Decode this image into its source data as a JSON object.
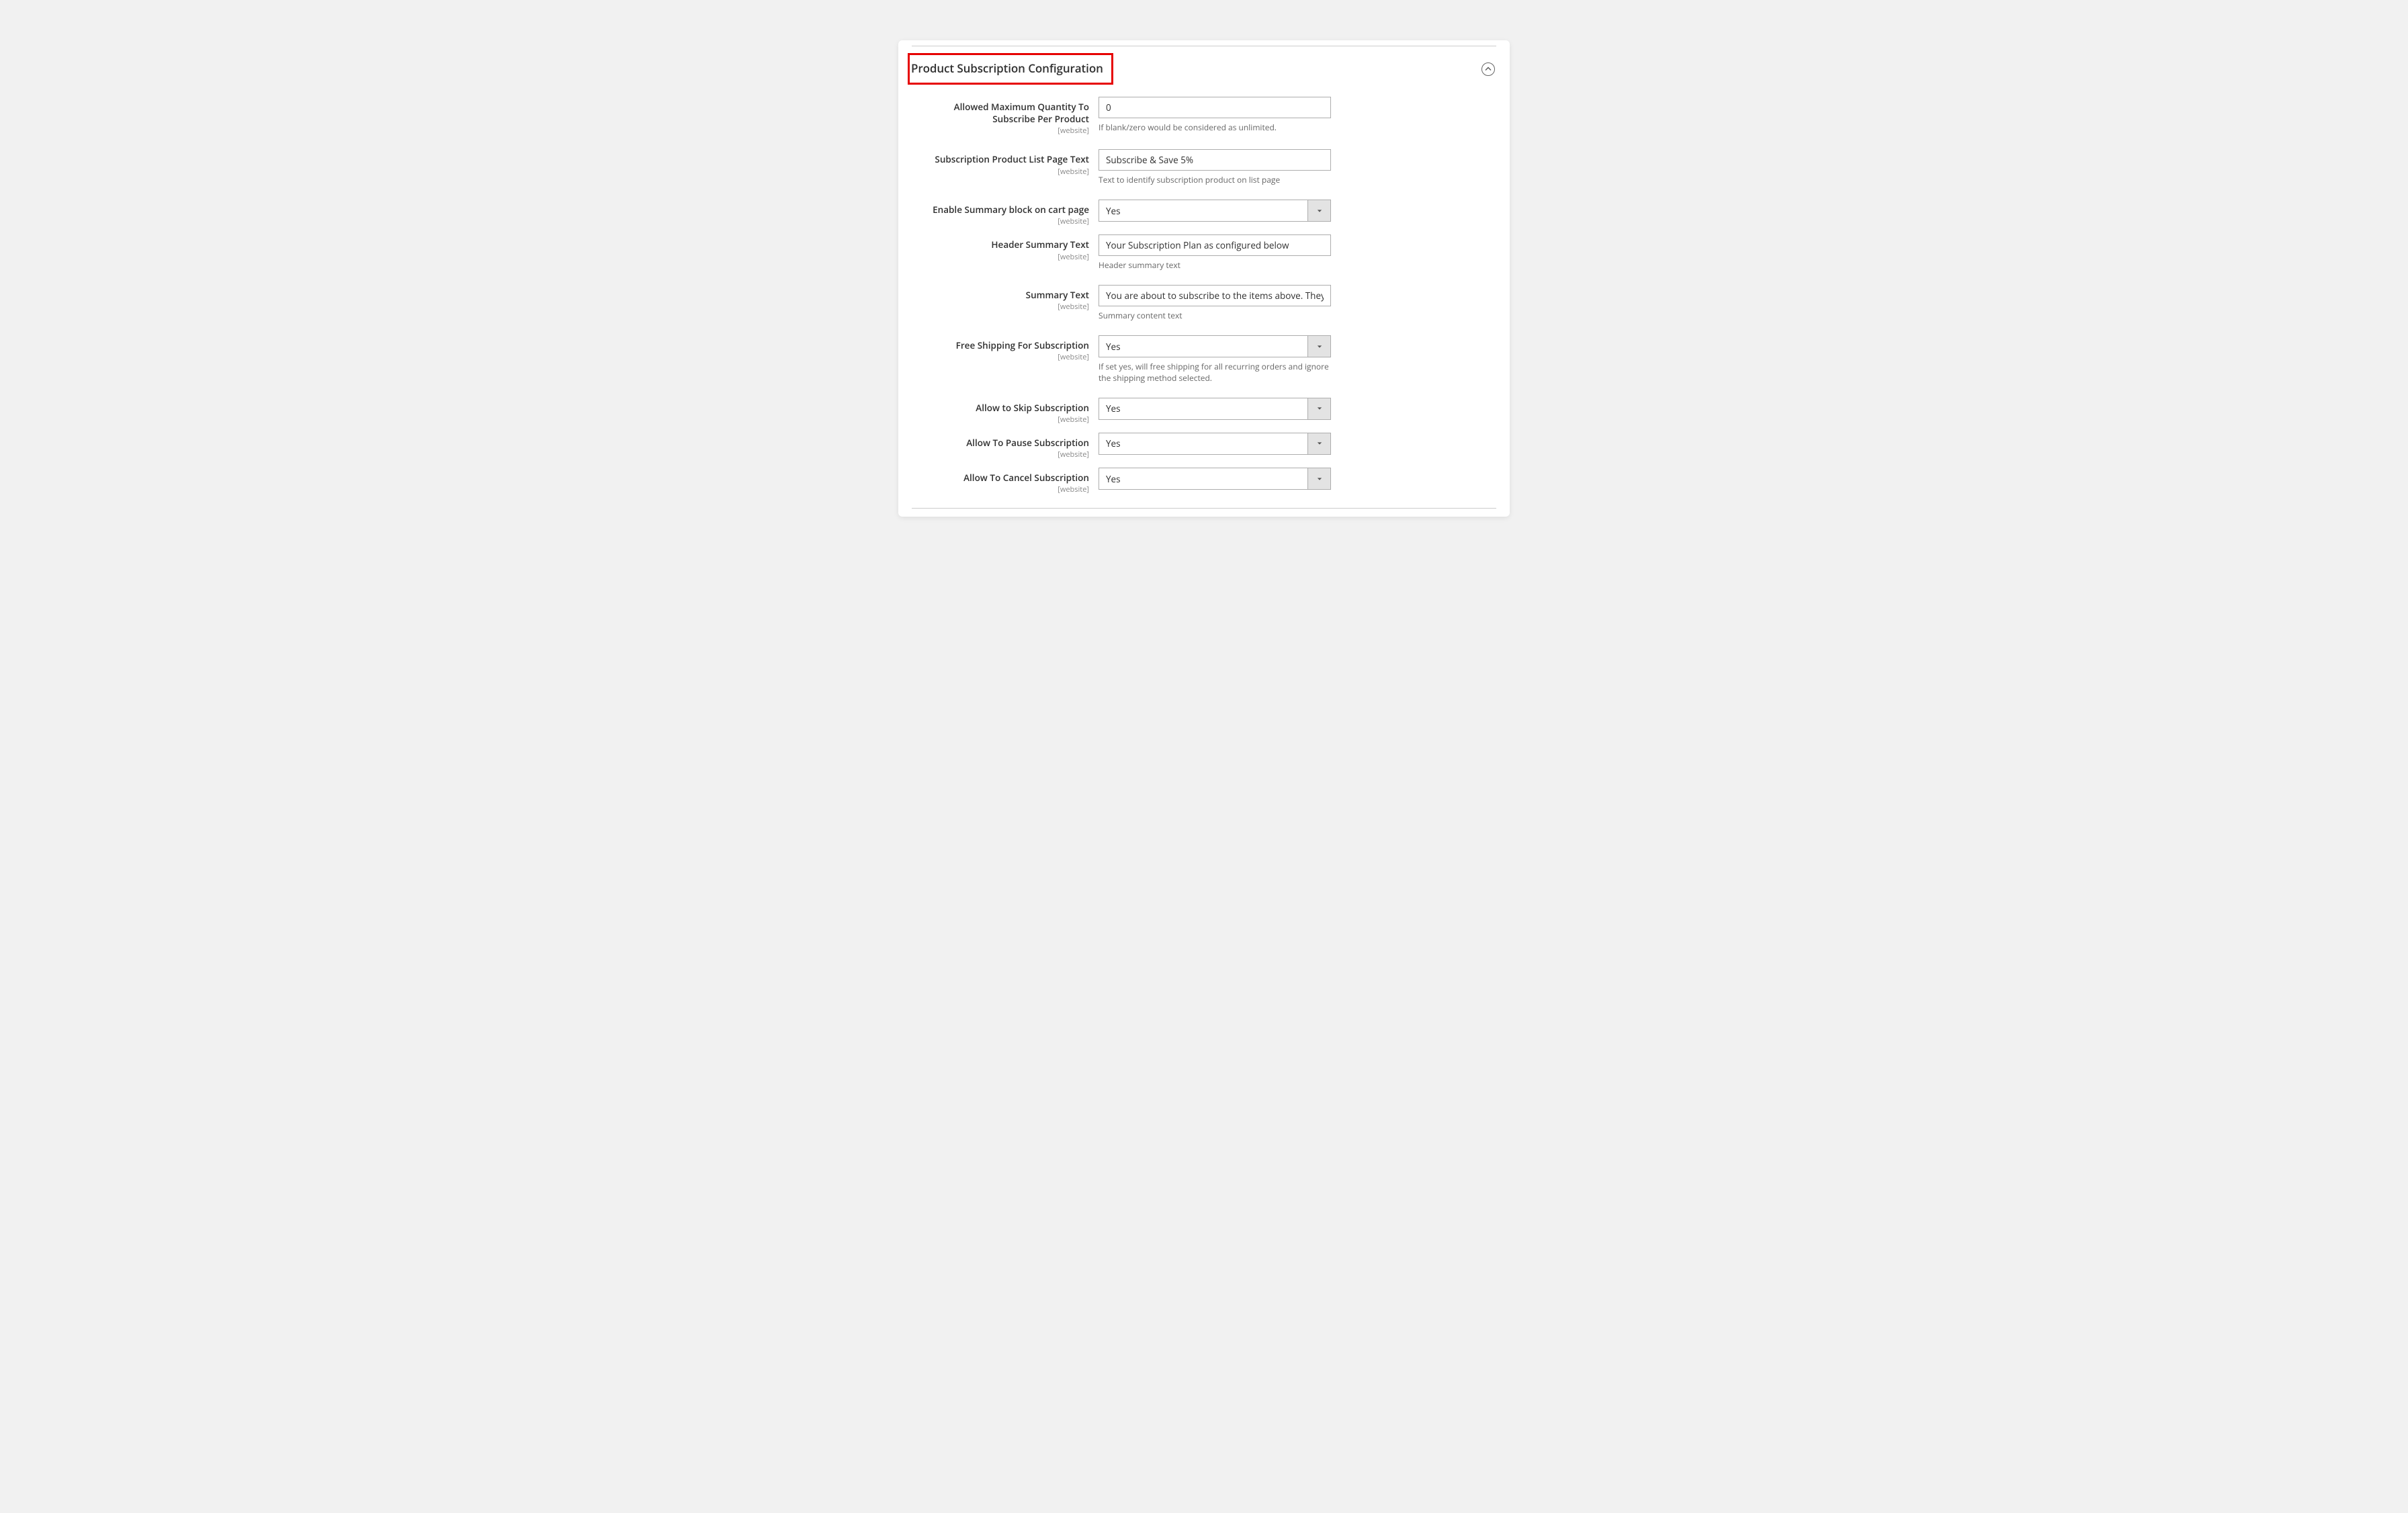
{
  "section": {
    "title": "Product Subscription Configuration"
  },
  "scope": "[website]",
  "fields": {
    "max_qty": {
      "label": "Allowed Maximum Quantity To Subscribe Per Product",
      "value": "0",
      "help": "If blank/zero would be considered as unlimited."
    },
    "list_text": {
      "label": "Subscription Product List Page Text",
      "value": "Subscribe & Save 5%",
      "help": "Text to identify subscription product on list page"
    },
    "enable_summary": {
      "label": "Enable Summary block on cart page",
      "value": "Yes"
    },
    "header_summary": {
      "label": "Header Summary Text",
      "value": "Your Subscription Plan as configured below",
      "help": "Header summary text"
    },
    "summary_text": {
      "label": "Summary Text",
      "value": "You are about to subscribe to the items above. They will be shipped to you on a recurring basis.",
      "help": "Summary content text"
    },
    "free_shipping": {
      "label": "Free Shipping For Subscription",
      "value": "Yes",
      "help": "If set yes, will free shipping for all recurring orders and ignore the shipping method selected."
    },
    "allow_skip": {
      "label": "Allow to Skip Subscription",
      "value": "Yes"
    },
    "allow_pause": {
      "label": "Allow To Pause Subscription",
      "value": "Yes"
    },
    "allow_cancel": {
      "label": "Allow To Cancel Subscription",
      "value": "Yes"
    }
  }
}
